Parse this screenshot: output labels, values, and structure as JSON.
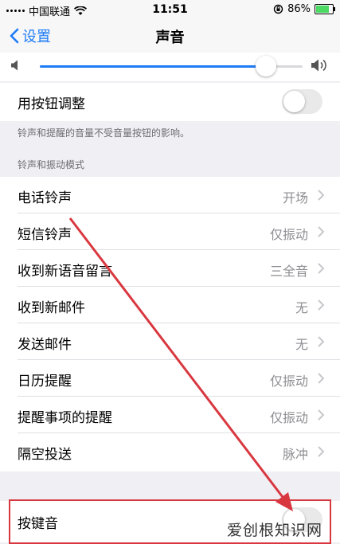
{
  "status_bar": {
    "carrier": "中国联通",
    "time": "11:51",
    "battery": "86%",
    "battery_level": 0.86
  },
  "nav": {
    "back_label": "设置",
    "title": "声音"
  },
  "volume": {
    "level": 0.86
  },
  "adjust_with_buttons": {
    "label": "用按钮调整",
    "on": false
  },
  "notes": {
    "buttons_note": "铃声和提醒的音量不受音量按钮的影响。",
    "section_header": "铃声和振动模式"
  },
  "sounds": [
    {
      "label": "电话铃声",
      "value": "开场"
    },
    {
      "label": "短信铃声",
      "value": "仅振动"
    },
    {
      "label": "收到新语音留言",
      "value": "三全音"
    },
    {
      "label": "收到新邮件",
      "value": "无"
    },
    {
      "label": "发送邮件",
      "value": "无"
    },
    {
      "label": "日历提醒",
      "value": "仅振动"
    },
    {
      "label": "提醒事项的提醒",
      "value": "仅振动"
    },
    {
      "label": "隔空投送",
      "value": "脉冲"
    }
  ],
  "keyboard_clicks": {
    "label": "按键音"
  },
  "watermark": "爱创根知识网",
  "colors": {
    "accent": "#1e7cf6",
    "annotation": "#d9373f",
    "battery": "#4cd964"
  }
}
